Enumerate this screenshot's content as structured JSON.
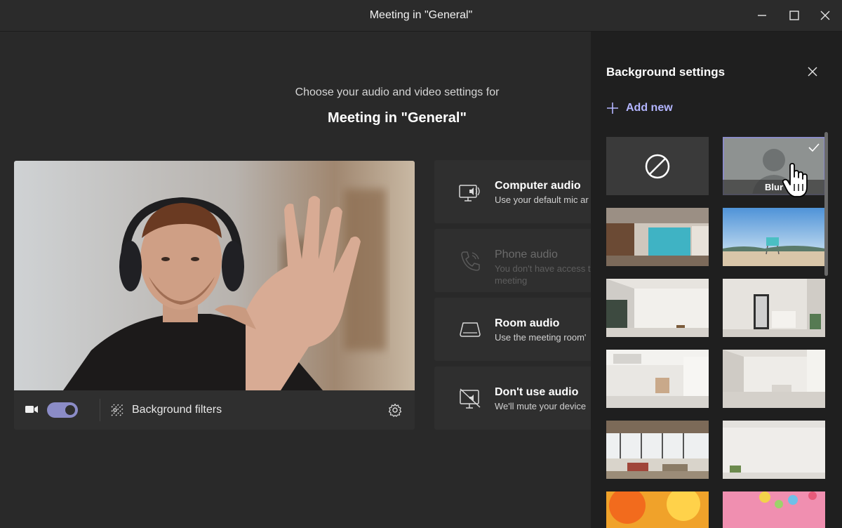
{
  "window": {
    "title": "Meeting in \"General\""
  },
  "main": {
    "subtitle": "Choose your audio and video settings for",
    "meeting_title": "Meeting in \"General\"",
    "preview_bar": {
      "background_filters_label": "Background filters",
      "camera_on": true
    }
  },
  "audio_options": [
    {
      "title": "Computer audio",
      "description": "Use your default mic ar",
      "icon": "computer-speaker-icon",
      "enabled": true
    },
    {
      "title": "Phone audio",
      "description": "You don't have access t",
      "description_line2": "meeting",
      "icon": "phone-icon",
      "enabled": false
    },
    {
      "title": "Room audio",
      "description": "Use the meeting room'",
      "icon": "room-device-icon",
      "enabled": true
    },
    {
      "title": "Don't use audio",
      "description": "We'll mute your device",
      "icon": "no-audio-icon",
      "enabled": true
    }
  ],
  "background_panel": {
    "title": "Background settings",
    "add_new_label": "Add new",
    "blur_label": "Blur",
    "selected": "Blur",
    "thumbnails": [
      "none",
      "blur",
      "office-lockers",
      "beach-lifeguard",
      "white-room-window",
      "white-room-mirror",
      "loft-stairs",
      "white-studio",
      "industrial-loft",
      "bright-room",
      "orange-balls",
      "pink-balls"
    ]
  },
  "colors": {
    "accent": "#8b8cc7",
    "link": "#b3b5ff",
    "panel_bg": "#1f1f1f",
    "main_bg": "#292929"
  }
}
